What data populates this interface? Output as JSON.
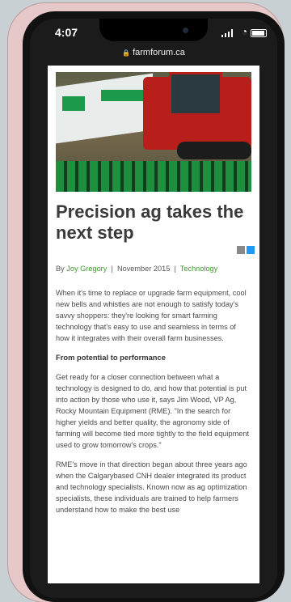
{
  "status": {
    "time": "4:07"
  },
  "browser": {
    "url": "farmforum.ca"
  },
  "article": {
    "title": "Precision ag takes the next step",
    "by_prefix": "By",
    "author": "Joy Gregory",
    "sep": "|",
    "date": "November 2015",
    "category": "Technology",
    "para1": "When it's time to replace or upgrade farm equipment, cool new bells and whistles are not enough to satisfy today's savvy shoppers: they're looking for smart farming technology that's easy to use and seamless in terms of how it integrates with their overall farm businesses.",
    "subhead": "From potential to performance",
    "para2": "Get ready for a closer connection between what a technology is designed to do, and how that potential is put into action by those who use it, says Jim Wood, VP Ag, Rocky Mountain Equipment (RME). \"In the search for higher yields and better quality, the agronomy side of farming will become tied more tightly to the field equipment used to grow tomorrow's crops.\"",
    "para3": "RME's move in that direction began about three years ago when the Calgarybased CNH dealer integrated its product and technology specialists. Known now as ag optimization specialists, these individuals are trained to help farmers understand how to make the best use"
  },
  "colors": {
    "link": "#3f9a2e",
    "twitter": "#1d9bf0"
  },
  "icons": [
    "lock-icon",
    "email-share-icon",
    "twitter-share-icon",
    "signal-icon",
    "wifi-icon",
    "battery-icon"
  ]
}
